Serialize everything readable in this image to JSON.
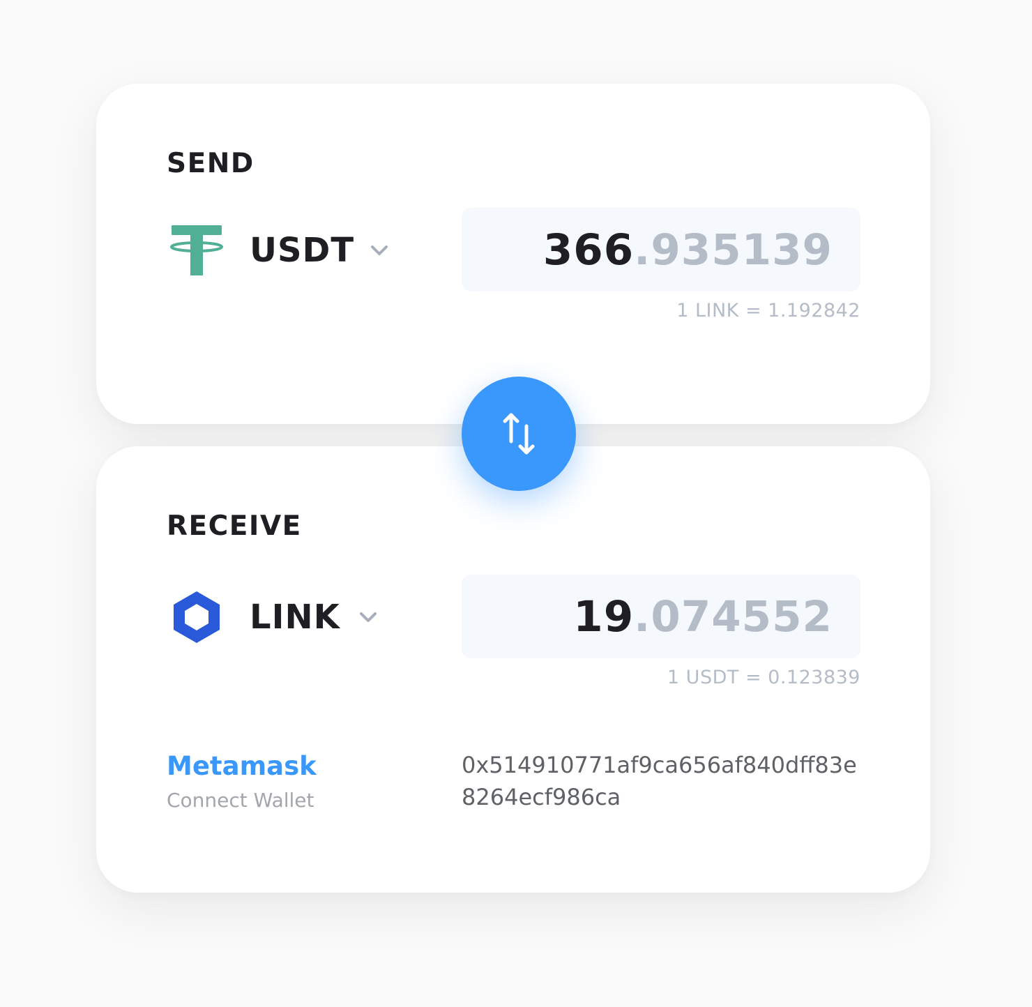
{
  "send": {
    "title": "SEND",
    "token": "USDT",
    "token_icon": "tether-icon",
    "amount_integer": "366",
    "amount_decimal": ".935139",
    "rate": "1 LINK = 1.192842"
  },
  "swap": {
    "icon": "swap-arrows-icon"
  },
  "receive": {
    "title": "RECEIVE",
    "token": "LINK",
    "token_icon": "chainlink-icon",
    "amount_integer": "19",
    "amount_decimal": ".074552",
    "rate": "1 USDT = 0.123839"
  },
  "wallet": {
    "name": "Metamask",
    "action": "Connect Wallet",
    "address": "0x514910771af9ca656af840dff83e8264ecf986ca"
  },
  "colors": {
    "accent": "#3a97fb",
    "tether": "#50af95",
    "chainlink": "#2a5ada",
    "text_dark": "#1f1f23",
    "text_muted": "#b3bcc7"
  }
}
